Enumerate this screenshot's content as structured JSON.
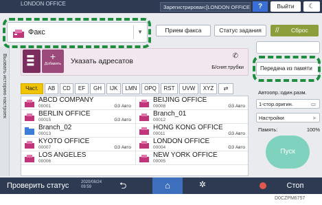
{
  "topbar": {
    "office": "LONDON OFFICE",
    "login_status": "Зарегистрирован:[LONDON OFFICE]",
    "help_label": "?",
    "logout_label": "Выйти",
    "moon_label": "☾"
  },
  "mode": {
    "label": "Факс",
    "dropdown": "▼"
  },
  "toolbar": {
    "receive_label": "Прием факса",
    "status_label": "Статус задания",
    "reset_label": "Сброс",
    "reset_icon": "//"
  },
  "history_tab_label": "Вызвать историю настроек",
  "destination": {
    "title": "Указать адресатов",
    "add_label": "Добавить",
    "add_icon": "+",
    "phone_icon": "✆",
    "on_hook_label": "Б/снят.трубки"
  },
  "tabs": [
    "Част.",
    "AB",
    "CD",
    "EF",
    "GH",
    "IJK",
    "LMN",
    "OPQ",
    "RST",
    "UVW",
    "XYZ",
    "⇄"
  ],
  "entries": [
    {
      "name": "ABCD COMPANY",
      "number": "00001",
      "mode": "G3 Авто"
    },
    {
      "name": "BEIJING OFFICE",
      "number": "00008",
      "mode": "G3 Авто"
    },
    {
      "name": "BERLIN OFFICE",
      "number": "00015",
      "mode": "G3 Авто"
    },
    {
      "name": "Branch_01",
      "number": "00012",
      "mode": ""
    },
    {
      "name": "Branch_02",
      "number": "00013",
      "mode": ""
    },
    {
      "name": "HONG KONG OFFICE",
      "number": "00011",
      "mode": "G3 Авто"
    },
    {
      "name": "KYOTO OFFICE",
      "number": "00007",
      "mode": "G3 Авто"
    },
    {
      "name": "LONDON OFFICE",
      "number": "00004",
      "mode": "G3 Авто"
    },
    {
      "name": "LOS ANGELES",
      "number": "00006",
      "mode": ""
    },
    {
      "name": "NEW YORK OFFICE",
      "number": "00005",
      "mode": ""
    }
  ],
  "side": {
    "memory_tx_label": "Передача из памяти",
    "auto_reduce_label": "Автоопр.:один.разм.",
    "one_sided_label": "1-стор.оригин.",
    "settings_label": "Настройки",
    "settings_chevron": ">",
    "memory_label": "Память:",
    "memory_value": "100%",
    "start_label": "Пуск"
  },
  "bottombar": {
    "check_status_label": "Проверить статус",
    "date": "2020/08/24",
    "time": "09:59",
    "back_icon": "⮌",
    "home_icon": "⌂",
    "gear_icon": "✲",
    "stop_label": "Стоп"
  },
  "figure_code": "D0CZPM6757",
  "colors": {
    "accent_green": "#1e8e3e",
    "tab_active": "#f1c400",
    "fax_icon": "#c0347a",
    "start_button": "#7fd3be"
  }
}
